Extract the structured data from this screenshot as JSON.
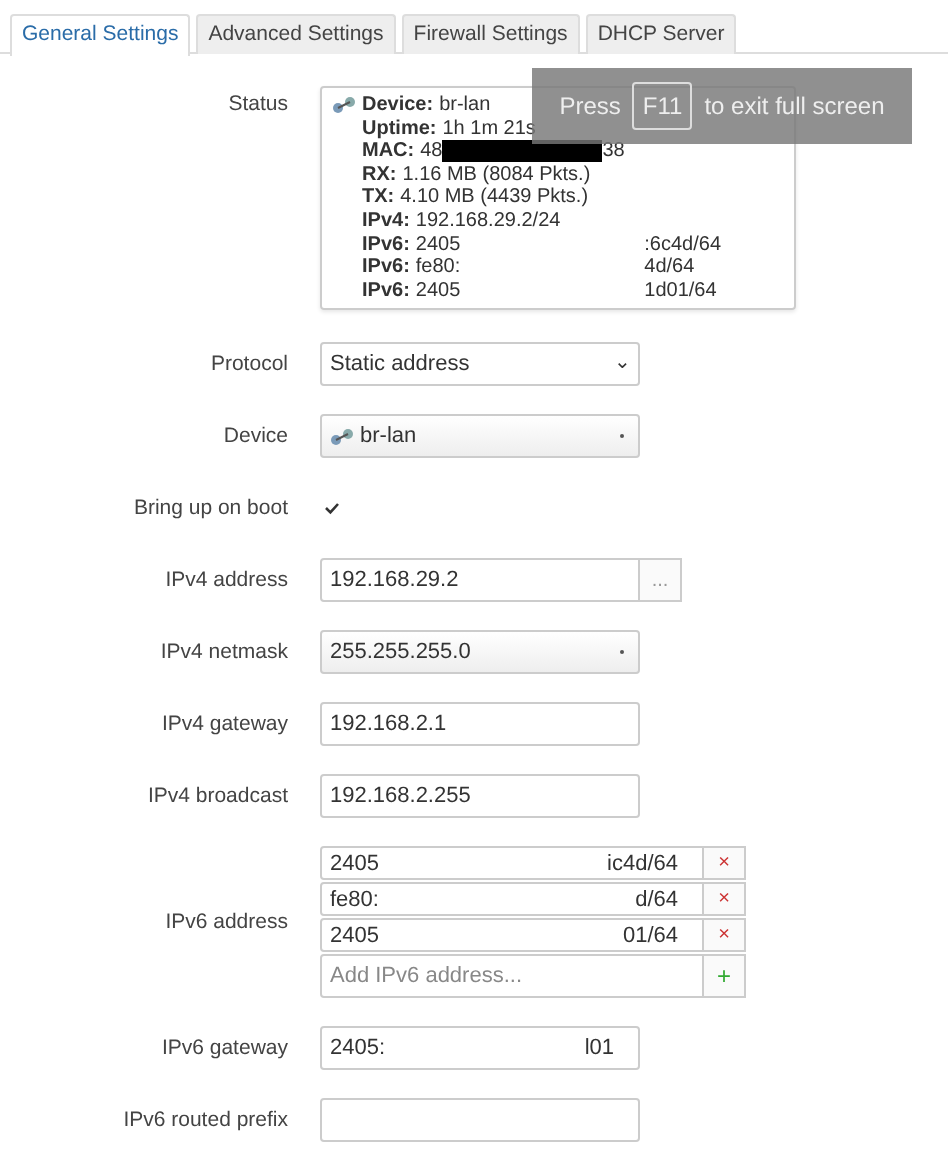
{
  "tabs": [
    {
      "label": "General Settings",
      "selected": true
    },
    {
      "label": "Advanced Settings",
      "selected": false
    },
    {
      "label": "Firewall Settings",
      "selected": false
    },
    {
      "label": "DHCP Server",
      "selected": false
    }
  ],
  "status": {
    "label": "Status",
    "lines": [
      {
        "key": "Device:",
        "value": "br-lan"
      },
      {
        "key": "Uptime:",
        "value": "1h 1m 21s"
      },
      {
        "key": "MAC:",
        "value": "48",
        "redacted": true,
        "value_end": "38"
      },
      {
        "key": "RX:",
        "value": "1.16 MB (8084 Pkts.)"
      },
      {
        "key": "TX:",
        "value": "4.10 MB (4439 Pkts.)"
      },
      {
        "key": "IPv4:",
        "value": "192.168.29.2/24"
      },
      {
        "key": "IPv6:",
        "value": "2405",
        "value_end": ":6c4d/64"
      },
      {
        "key": "IPv6:",
        "value": "fe80:",
        "value_end": "4d/64"
      },
      {
        "key": "IPv6:",
        "value": "2405",
        "value_end": "1d01/64"
      }
    ]
  },
  "fields": [
    {
      "kind": "select",
      "label": "Protocol",
      "value": "Static address",
      "arrow": "⌄"
    },
    {
      "kind": "device",
      "label": "Device",
      "value": "br-lan"
    },
    {
      "kind": "checkbox",
      "label": "Bring up on boot",
      "checked": true
    },
    {
      "kind": "text-button",
      "label": "IPv4 address",
      "value": "192.168.29.2",
      "button": "..."
    },
    {
      "kind": "dropdown",
      "label": "IPv4 netmask",
      "value": "255.255.255.0"
    },
    {
      "kind": "text",
      "label": "IPv4 gateway",
      "value": "192.168.2.1"
    },
    {
      "kind": "text",
      "label": "IPv4 broadcast",
      "value": "192.168.2.255"
    },
    {
      "kind": "list",
      "label": "IPv6 address",
      "items": [
        {
          "value": "2405",
          "value_end": "ic4d/64",
          "button": "×"
        },
        {
          "value": "fe80:",
          "value_end": "d/64",
          "button": "×"
        },
        {
          "value": "2405",
          "value_end": "01/64",
          "button": "×"
        }
      ],
      "add": {
        "placeholder": "Add IPv6 address...",
        "button": "+"
      }
    },
    {
      "kind": "split",
      "label": "IPv6 gateway",
      "value": "2405:",
      "value_end": "l01"
    },
    {
      "kind": "text",
      "label": "IPv6 routed prefix"
    }
  ],
  "overlay": {
    "before": "Press",
    "key": "F11",
    "after": "to exit full screen"
  }
}
